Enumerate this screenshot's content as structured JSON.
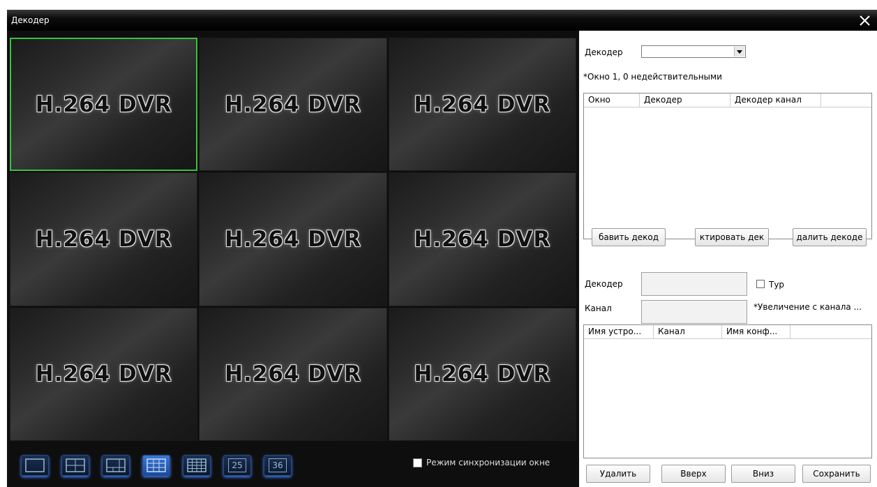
{
  "window": {
    "title": "Декодер"
  },
  "video": {
    "cells": [
      "H.264 DVR",
      "H.264 DVR",
      "H.264 DVR",
      "H.264 DVR",
      "H.264 DVR",
      "H.264 DVR",
      "H.264 DVR",
      "H.264 DVR",
      "H.264 DVR"
    ],
    "selected_index": 0,
    "accent_color": "#3cc23c"
  },
  "layout_bar": {
    "buttons": [
      {
        "name": "layout-1-icon",
        "label": ""
      },
      {
        "name": "layout-4-icon",
        "label": ""
      },
      {
        "name": "layout-6-icon",
        "label": ""
      },
      {
        "name": "layout-9-icon",
        "label": "",
        "active": true
      },
      {
        "name": "layout-16-icon",
        "label": ""
      },
      {
        "name": "layout-25-icon",
        "label": "25"
      },
      {
        "name": "layout-36-icon",
        "label": "36"
      }
    ],
    "sync_label": "Режим синхронизации окне"
  },
  "panel": {
    "decoder_label": "Декодер",
    "note": "*Окно 1, 0 недействительными",
    "table1_headers": [
      "Окно",
      "Декодер",
      "Декодер канал"
    ],
    "add_button": "бавить декод",
    "edit_button": "ктировать дек",
    "delete_decoder_button": "далить декоде",
    "decoder2_label": "Декодер",
    "tour_label": "Тур",
    "channel_label": "Канал",
    "zoom_note": "*Увеличение с канала ...",
    "table2_headers": [
      "Имя устро...",
      "Канал",
      "Имя конф..."
    ],
    "delete_button": "Удалить",
    "up_button": "Вверх",
    "down_button": "Вниз",
    "save_button": "Сохранить"
  }
}
